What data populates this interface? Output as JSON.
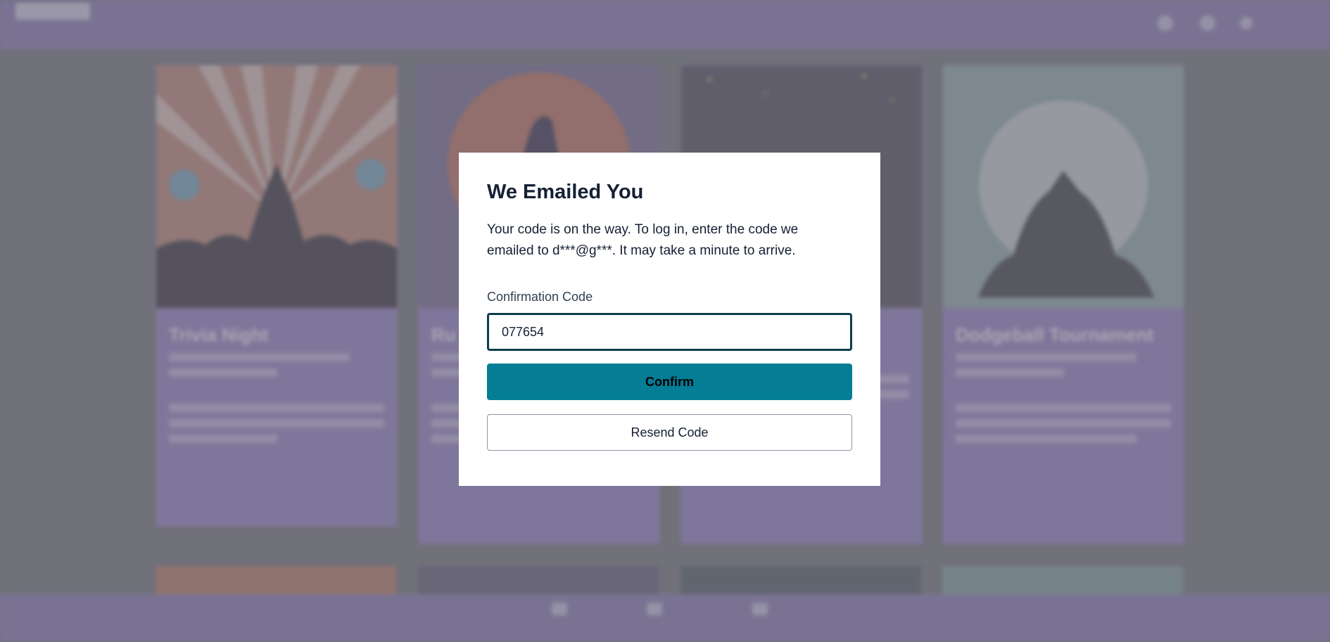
{
  "colors": {
    "accent": "#047d95",
    "dialog_text": "#152033",
    "input_border": "#0b3e4d",
    "header_bg": "#9d8fc0",
    "card_bg": "#a796cf"
  },
  "background": {
    "cards": [
      {
        "title": "Trivia Night"
      },
      {
        "title": "Ru"
      },
      {
        "title": ""
      },
      {
        "title": "Dodgeball Tournament"
      }
    ]
  },
  "dialog": {
    "title": "We Emailed You",
    "description": "Your code is on the way. To log in, enter the code we emailed to d***@g***. It may take a minute to arrive.",
    "code_label": "Confirmation Code",
    "code_value": "077654",
    "confirm_label": "Confirm",
    "resend_label": "Resend Code"
  }
}
